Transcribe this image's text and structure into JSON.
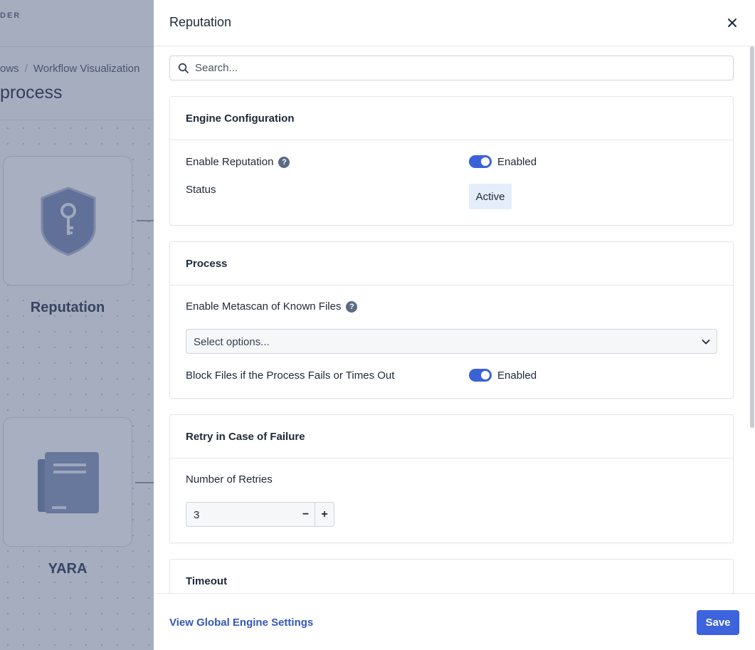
{
  "background": {
    "logo_text": "DER",
    "breadcrumb": [
      "ows",
      "Workflow Visualization"
    ],
    "breadcrumb_separator": "/",
    "page_title": "process",
    "nodes": [
      {
        "label": "Reputation",
        "icon": "shield-key-icon"
      },
      {
        "label": "YARA",
        "icon": "document-icon"
      }
    ]
  },
  "drawer": {
    "title": "Reputation",
    "close_icon": "close-icon",
    "search": {
      "placeholder": "Search...",
      "value": ""
    },
    "sections": {
      "engine": {
        "title": "Engine Configuration",
        "enable_label": "Enable Reputation",
        "enable_state": "Enabled",
        "status_label": "Status",
        "status_value": "Active"
      },
      "process": {
        "title": "Process",
        "metascan_label": "Enable Metascan of Known Files",
        "select_placeholder": "Select options...",
        "block_label": "Block Files if the Process Fails or Times Out",
        "block_state": "Enabled"
      },
      "retry": {
        "title": "Retry in Case of Failure",
        "retries_label": "Number of Retries",
        "retries_value": "3",
        "minus": "−",
        "plus": "+"
      },
      "timeout": {
        "title": "Timeout"
      }
    },
    "footer": {
      "link": "View Global Engine Settings",
      "save": "Save"
    }
  },
  "colors": {
    "accent": "#3d63dd",
    "toggle_on": "#3a63d8",
    "status_bg": "#e5edfb",
    "link": "#3557b8"
  }
}
